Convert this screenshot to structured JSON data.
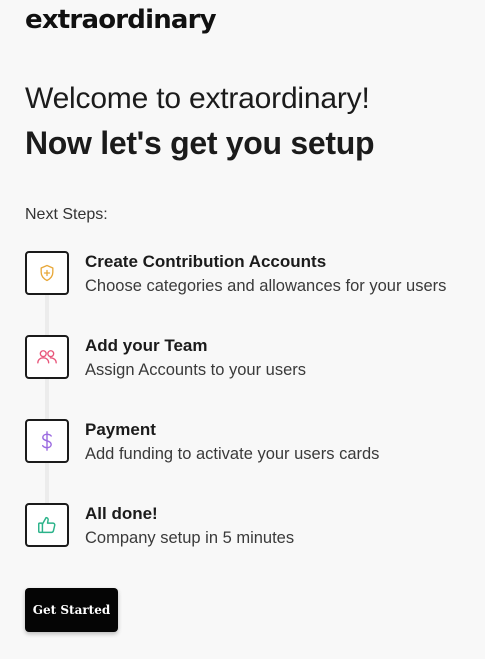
{
  "brand": {
    "logo_text": "extraordinary"
  },
  "header": {
    "welcome": "Welcome to extraordinary!",
    "subtitle": "Now let's get you setup"
  },
  "steps_section": {
    "label": "Next Steps:",
    "steps": [
      {
        "title": "Create Contribution Accounts",
        "description": "Choose categories and allowances for your users",
        "icon": "shield-plus-icon",
        "icon_color": "#e8a83a"
      },
      {
        "title": "Add your Team",
        "description": "Assign Accounts to your users",
        "icon": "users-icon",
        "icon_color": "#e8557a"
      },
      {
        "title": "Payment",
        "description": "Add funding to activate your users cards",
        "icon": "dollar-icon",
        "icon_color": "#9b6be0"
      },
      {
        "title": "All done!",
        "description": "Company setup in 5 minutes",
        "icon": "thumbs-up-icon",
        "icon_color": "#2bb38a"
      }
    ]
  },
  "cta": {
    "label": "Get Started"
  }
}
